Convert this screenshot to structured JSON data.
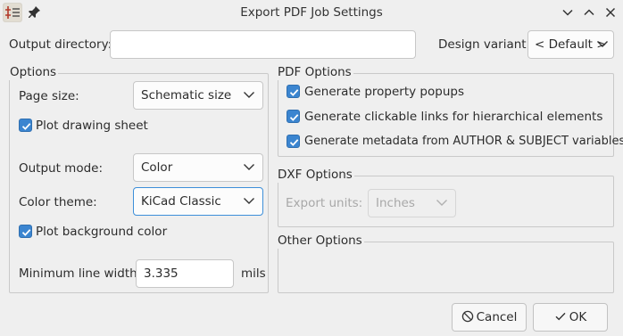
{
  "window": {
    "title": "Export PDF Job Settings",
    "controls": [
      "chevron-down-icon",
      "chevron-up-icon",
      "close-icon"
    ]
  },
  "output_directory": {
    "label": "Output directory:",
    "value": ""
  },
  "design_variant": {
    "label": "Design variant:",
    "value": "< Default >"
  },
  "options": {
    "title": "Options",
    "page_size": {
      "label": "Page size:",
      "value": "Schematic size"
    },
    "plot_drawing_sheet": {
      "label": "Plot drawing sheet",
      "checked": true
    },
    "output_mode": {
      "label": "Output mode:",
      "value": "Color"
    },
    "color_theme": {
      "label": "Color theme:",
      "value": "KiCad Classic"
    },
    "plot_background_color": {
      "label": "Plot background color",
      "checked": true
    },
    "min_line_width": {
      "label": "Minimum line width:",
      "value": "3.335",
      "unit": "mils"
    }
  },
  "pdf_options": {
    "title": "PDF Options",
    "property_popups": {
      "label": "Generate property popups",
      "checked": true
    },
    "clickable_links": {
      "label": "Generate clickable links for hierarchical elements",
      "checked": true
    },
    "metadata": {
      "label": "Generate metadata from AUTHOR & SUBJECT variables",
      "checked": true
    }
  },
  "dxf_options": {
    "title": "DXF Options",
    "export_units": {
      "label": "Export units:",
      "value": "Inches"
    }
  },
  "other_options": {
    "title": "Other Options"
  },
  "buttons": {
    "cancel": "Cancel",
    "ok": "OK"
  },
  "colors": {
    "accent": "#3b85d0",
    "background": "#efefef",
    "border": "#c9c9c9"
  }
}
